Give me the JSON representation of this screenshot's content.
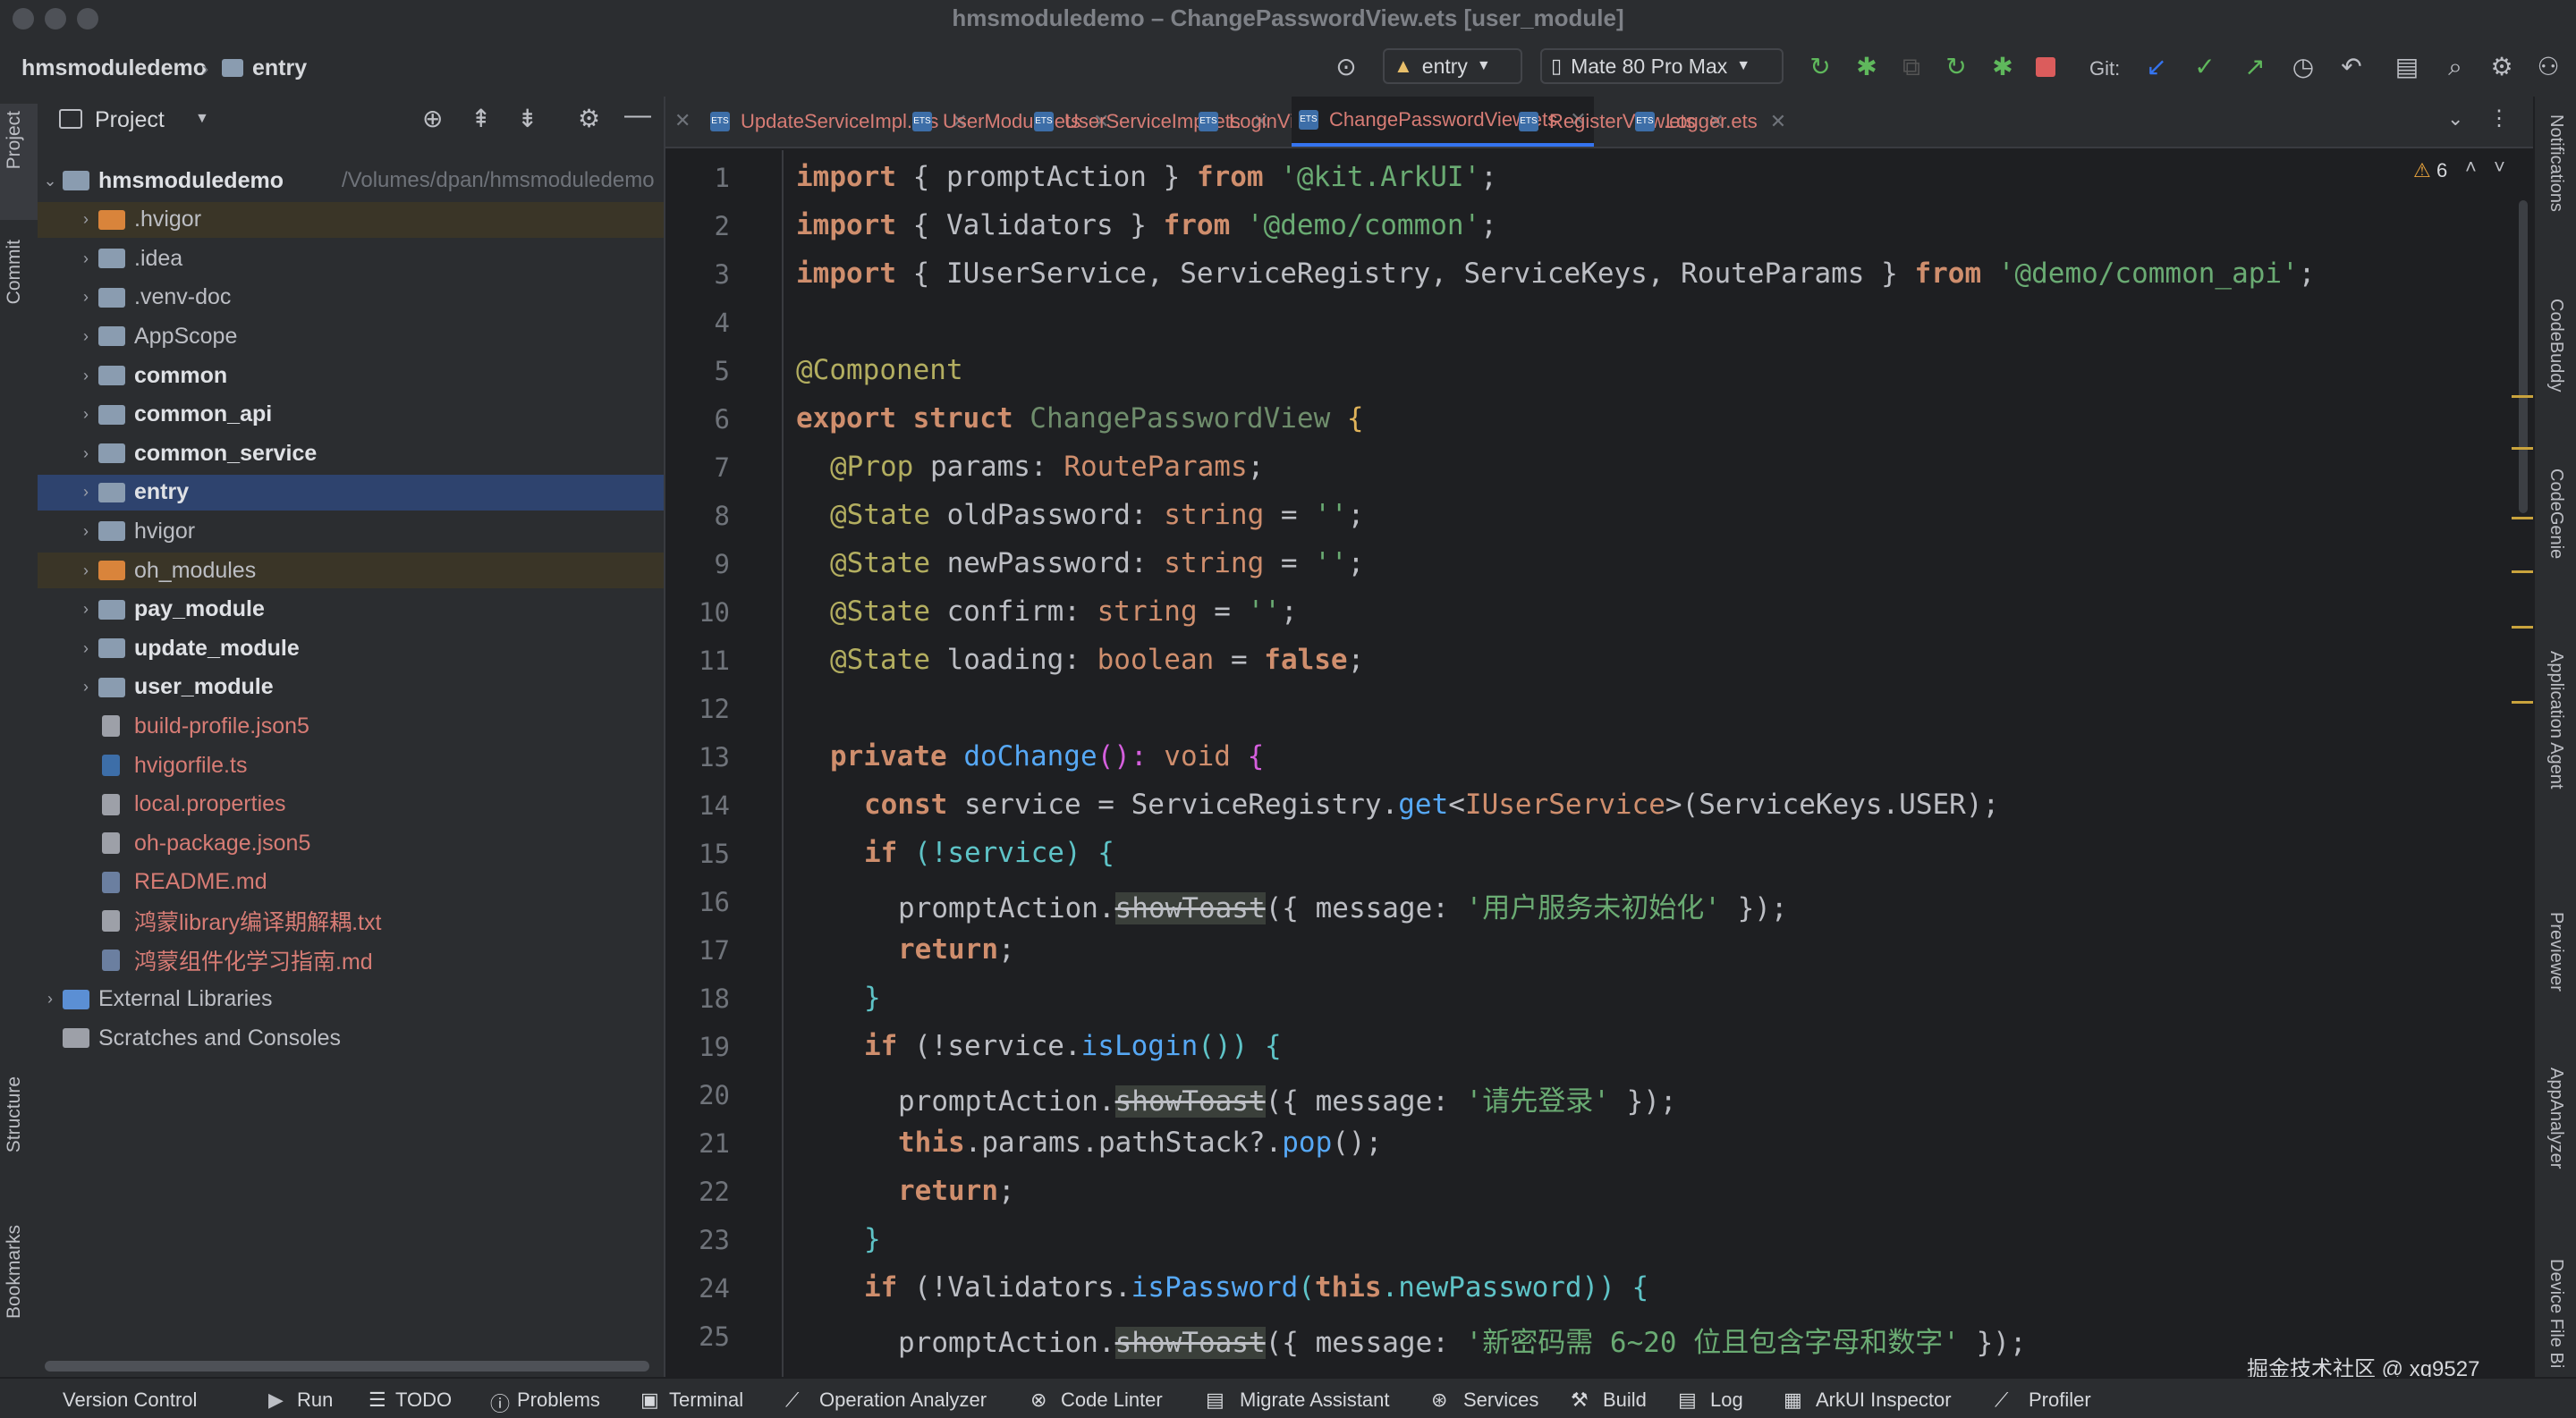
{
  "window": {
    "title": "hmsmoduledemo – ChangePasswordView.ets [user_module]"
  },
  "toolbar": {
    "breadcrumb": [
      "hmsmoduledemo",
      "entry"
    ],
    "module_select": "entry",
    "device_select": "Mate 80 Pro Max",
    "git_label": "Git:"
  },
  "project": {
    "title": "Project",
    "tree": [
      {
        "label": "hmsmoduledemo",
        "path": "/Volumes/dpan/hmsmoduledemo",
        "bold": true
      },
      {
        "label": ".hvigor"
      },
      {
        "label": ".idea"
      },
      {
        "label": ".venv-doc"
      },
      {
        "label": "AppScope"
      },
      {
        "label": "common",
        "bold": true
      },
      {
        "label": "common_api",
        "bold": true
      },
      {
        "label": "common_service",
        "bold": true
      },
      {
        "label": "entry",
        "bold": true
      },
      {
        "label": "hvigor"
      },
      {
        "label": "oh_modules"
      },
      {
        "label": "pay_module",
        "bold": true
      },
      {
        "label": "update_module",
        "bold": true
      },
      {
        "label": "user_module",
        "bold": true
      },
      {
        "label": "build-profile.json5"
      },
      {
        "label": "hvigorfile.ts"
      },
      {
        "label": "local.properties"
      },
      {
        "label": "oh-package.json5"
      },
      {
        "label": "README.md"
      },
      {
        "label": "鸿蒙library编译期解耦.txt"
      },
      {
        "label": "鸿蒙组件化学习指南.md"
      },
      {
        "label": "External Libraries"
      },
      {
        "label": "Scratches and Consoles"
      }
    ]
  },
  "left_tools": [
    "Project",
    "Commit",
    "Structure",
    "Bookmarks"
  ],
  "tabs": [
    {
      "label": "UpdateServiceImpl.ets"
    },
    {
      "label": "UserModule.ets"
    },
    {
      "label": "UserServiceImpl.ets"
    },
    {
      "label": "LoginView.ets"
    },
    {
      "label": "ChangePasswordView.ets",
      "active": true
    },
    {
      "label": "RegisterView.ets"
    },
    {
      "label": "Logger.ets"
    }
  ],
  "editor": {
    "warnings_count": "6",
    "line_numbers": [
      "1",
      "2",
      "3",
      "4",
      "5",
      "6",
      "7",
      "8",
      "9",
      "10",
      "11",
      "12",
      "13",
      "14",
      "15",
      "16",
      "17",
      "18",
      "19",
      "20",
      "21",
      "22",
      "23",
      "24",
      "25"
    ],
    "code": {
      "l1": {
        "a": "import",
        "b": " { promptAction } ",
        "c": "from",
        "d": " '@kit.ArkUI'",
        "e": ";"
      },
      "l2": {
        "a": "import",
        "b": " { Validators } ",
        "c": "from",
        "d": " '@demo/common'",
        "e": ";"
      },
      "l3": {
        "a": "import",
        "b": " { IUserService, ServiceRegistry, ServiceKeys, RouteParams } ",
        "c": "from",
        "d": " '@demo/common_api'",
        "e": ";"
      },
      "l5": "@Component",
      "l6": {
        "a": "export struct",
        "b": " ChangePasswordView",
        "c": " {"
      },
      "l7": {
        "a": "@Prop",
        "b": " params: ",
        "c": "RouteParams",
        "d": ";"
      },
      "l8": {
        "a": "@State",
        "b": " oldPassword: ",
        "c": "string",
        "d": " = ",
        "e": "''",
        "f": ";"
      },
      "l9": {
        "a": "@State",
        "b": " newPassword: ",
        "c": "string",
        "d": " = ",
        "e": "''",
        "f": ";"
      },
      "l10": {
        "a": "@State",
        "b": " confirm: ",
        "c": "string",
        "d": " = ",
        "e": "''",
        "f": ";"
      },
      "l11": {
        "a": "@State",
        "b": " loading: ",
        "c": "boolean",
        "d": " = ",
        "e": "false",
        "f": ";"
      },
      "l13": {
        "a": "private",
        "b": " doChange",
        "c": "(): ",
        "d": "void",
        "e": " {"
      },
      "l14": {
        "a": "const",
        "b": " service = ServiceRegistry.",
        "c": "get",
        "d": "<",
        "e": "IUserService",
        "f": ">(ServiceKeys.USER);"
      },
      "l15": {
        "a": "if",
        "b": " (!service) {"
      },
      "l16": {
        "a": "promptAction.",
        "b": "showToast",
        "c": "({ message: ",
        "d": "'用户服务未初始化'",
        "e": " });"
      },
      "l17": {
        "a": "return",
        "b": ";"
      },
      "l18": "}",
      "l19": {
        "a": "if",
        "b": " (!service.",
        "c": "isLogin",
        "d": "()) {"
      },
      "l20": {
        "a": "promptAction.",
        "b": "showToast",
        "c": "({ message: ",
        "d": "'请先登录'",
        "e": " });"
      },
      "l21": {
        "a": "this",
        "b": ".params.pathStack?.",
        "c": "pop",
        "d": "();"
      },
      "l22": {
        "a": "return",
        "b": ";"
      },
      "l23": "}",
      "l24": {
        "a": "if",
        "b": " (!Validators.",
        "c": "isPassword",
        "d": "(",
        "e": "this",
        "f": ".newPassword)) {"
      },
      "l25": {
        "a": "promptAction.",
        "b": "showToast",
        "c": "({ message: ",
        "d": "'新密码需 6~20 位且包含字母和数字'",
        "e": " });"
      }
    }
  },
  "right_tools": [
    "Notifications",
    "CodeBuddy",
    "CodeGenie",
    "Application Agent",
    "Previewer",
    "AppAnalyzer",
    "Device File Bi"
  ],
  "statusbar": [
    "Version Control",
    "Run",
    "TODO",
    "Problems",
    "Terminal",
    "Operation Analyzer",
    "Code Linter",
    "Migrate Assistant",
    "Services",
    "Build",
    "Log",
    "ArkUI Inspector",
    "Profiler"
  ],
  "watermark": "掘金技术社区 @ xq9527",
  "colors": {
    "accent": "#3574f0",
    "bg": "#1e1f22",
    "panel": "#2b2d30",
    "selected_row": "#2e436e",
    "error_red": "#d77c75"
  }
}
